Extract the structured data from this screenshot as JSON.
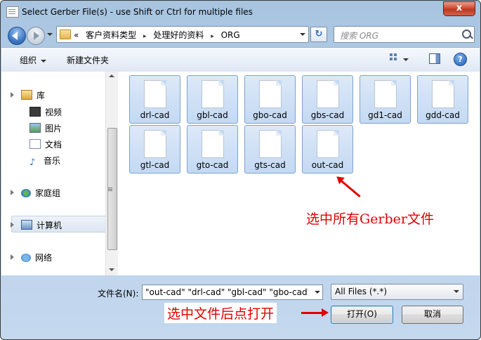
{
  "window": {
    "title": "Select Gerber File(s) - use Shift or Ctrl for multiple files",
    "close_label": "x"
  },
  "address": {
    "prefix": "«",
    "crumbs": [
      "客户资料类型",
      "处理好的资料",
      "ORG"
    ],
    "separator": "▸",
    "refresh_glyph": "↻"
  },
  "search": {
    "placeholder": "搜索 ORG"
  },
  "toolbar": {
    "organize_label": "组织",
    "new_folder_label": "新建文件夹",
    "help_glyph": "?"
  },
  "nav": {
    "libraries": "库",
    "videos": "视频",
    "pictures": "图片",
    "documents": "文档",
    "music": "音乐",
    "homegroup": "家庭组",
    "computer": "计算机",
    "network": "网络"
  },
  "files": [
    {
      "name": "drl-cad"
    },
    {
      "name": "gbl-cad"
    },
    {
      "name": "gbo-cad"
    },
    {
      "name": "gbs-cad"
    },
    {
      "name": "gd1-cad"
    },
    {
      "name": "gdd-cad"
    },
    {
      "name": "gtl-cad"
    },
    {
      "name": "gto-cad"
    },
    {
      "name": "gts-cad"
    },
    {
      "name": "out-cad"
    }
  ],
  "annotations": {
    "select_all": "选中所有Gerber文件",
    "select_then_open": "选中文件后点打开"
  },
  "bottom": {
    "filename_label": "文件名(N):",
    "filename_value": "\"out-cad\" \"drl-cad\" \"gbl-cad\" \"gbo-cad\"",
    "filetype_value": "All Files (*.*)",
    "open_label": "打开(O)",
    "cancel_label": "取消"
  },
  "colors": {
    "annotation_red": "#e00000",
    "selection_blue": "#c3d9f3",
    "window_frame": "#b9d1e9"
  }
}
